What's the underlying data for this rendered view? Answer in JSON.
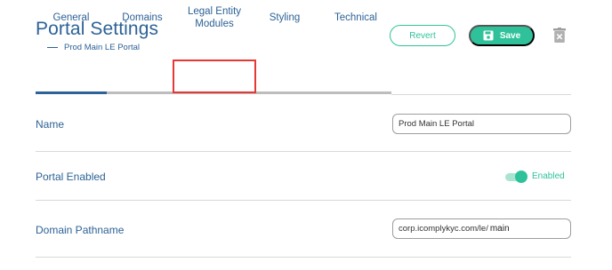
{
  "header": {
    "title": "Portal Settings",
    "subtitle": "Prod Main LE Portal",
    "revert_label": "Revert",
    "save_label": "Save"
  },
  "tabs": [
    {
      "label": "General",
      "active": true
    },
    {
      "label": "Domains",
      "active": false
    },
    {
      "label": "Legal Entity\nModules",
      "active": false,
      "highlighted": true
    },
    {
      "label": "Styling",
      "active": false
    },
    {
      "label": "Technical",
      "active": false
    }
  ],
  "rows": {
    "name": {
      "label": "Name",
      "value": "Prod Main LE Portal"
    },
    "portal_enabled": {
      "label": "Portal Enabled",
      "toggle_label": "Enabled",
      "enabled": true
    },
    "domain_pathname": {
      "label": "Domain Pathname",
      "prefix": "corp.icomplykyc.com/le/",
      "value": "main"
    }
  },
  "colors": {
    "primary_text": "#2d6296",
    "accent_green": "#2fc29a",
    "highlight_red": "#e53935"
  },
  "icons": {
    "save": "floppy-disk-icon",
    "delete": "trash-icon"
  }
}
